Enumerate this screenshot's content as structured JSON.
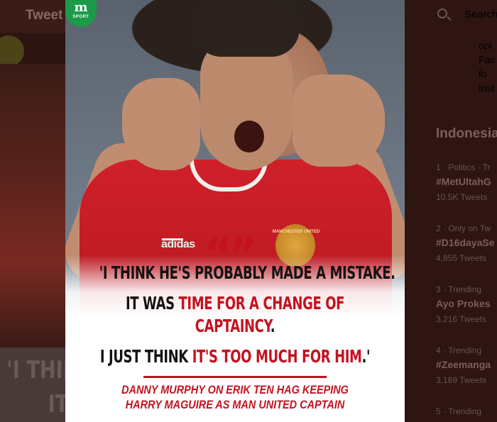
{
  "page": {
    "header_title": "Tweet"
  },
  "background_quote": {
    "line1": "'I THINK",
    "line2": "IT"
  },
  "sidebar": {
    "search_placeholder": "Search",
    "snippets": [
      "opi",
      "Fac",
      "fo",
      "Inst"
    ],
    "trends_heading": "Indonesia",
    "trends": [
      {
        "meta": "1 · Politics · Tr",
        "name": "#MetUltahG",
        "count": "10.5K Tweets"
      },
      {
        "meta": "2 · Only on Tw",
        "name": "#D16dayaSe",
        "count": "4,855 Tweets"
      },
      {
        "meta": "3 · Trending",
        "name": "Ayo Prokes",
        "count": "3,216 Tweets"
      },
      {
        "meta": "4 · Trending",
        "name": "#Zeemanga",
        "count": "3,169 Tweets"
      },
      {
        "meta": "5 · Trending",
        "name": "",
        "count": ""
      }
    ]
  },
  "media": {
    "logo": {
      "letter": "m",
      "label": "SPORT"
    },
    "jersey": {
      "brand": "adidas",
      "crest": "MANCHESTER UNITED"
    },
    "quote_mark": "“”",
    "quote": {
      "line1": "'I THINK HE'S PROBABLY MADE A MISTAKE.",
      "line2_plain": "IT WAS ",
      "line2_red": "TIME FOR A CHANGE OF",
      "line3_red": "CAPTAINCY",
      "line3_plain": ".",
      "line4_plain": "I JUST THINK ",
      "line4_red": "IT'S TOO MUCH FOR HIM",
      "line4_end": ".'"
    },
    "attribution": {
      "line1": "DANNY MURPHY ON ERIK TEN HAG KEEPING",
      "line2": "HARRY MAGUIRE AS MAN UNITED CAPTAIN"
    }
  }
}
